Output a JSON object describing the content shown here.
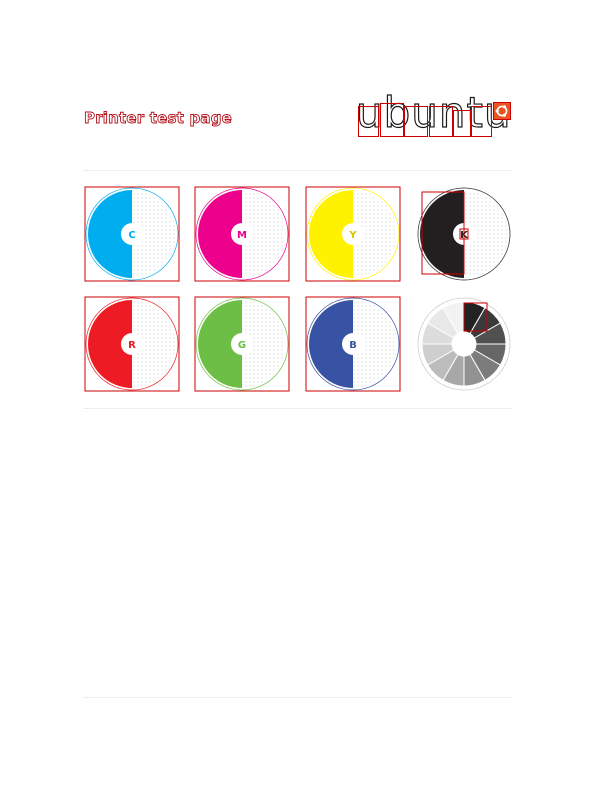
{
  "page": {
    "title": "Printer test page"
  },
  "logo": {
    "text": "ubuntu",
    "mark_color": "#e95420"
  },
  "colour_swatches": [
    {
      "label": "C",
      "color": "#00aeef"
    },
    {
      "label": "M",
      "color": "#ec008c"
    },
    {
      "label": "Y",
      "color": "#fff200"
    },
    {
      "label": "K",
      "color": "#231f20"
    },
    {
      "label": "R",
      "color": "#ed1c24"
    },
    {
      "label": "G",
      "color": "#6cbe45"
    },
    {
      "label": "B",
      "color": "#3953a4"
    }
  ],
  "gray_wheel": {
    "segments": [
      "#222222",
      "#3a3a3a",
      "#505050",
      "#666666",
      "#7c7c7c",
      "#929292",
      "#a8a8a8",
      "#bcbcbc",
      "#cecece",
      "#dcdcdc",
      "#e8e8e8",
      "#f2f2f2"
    ]
  },
  "annotation_color": "#cc0000"
}
